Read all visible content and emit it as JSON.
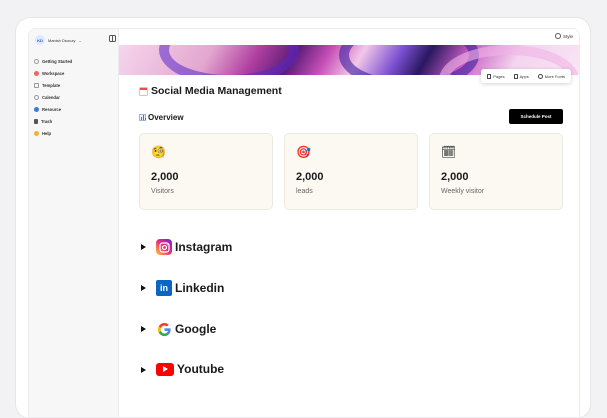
{
  "workspace": {
    "initials": "KD",
    "name": "Manish Dsouzy"
  },
  "sidebar": {
    "items": [
      {
        "label": "Getting Started",
        "icon": "compass-icon",
        "color": "#d9d9d9"
      },
      {
        "label": "Workspace",
        "icon": "workspace-icon",
        "color": "#e9685b"
      },
      {
        "label": "Template",
        "icon": "template-icon",
        "color": "#d9d9d9"
      },
      {
        "label": "Calendar",
        "icon": "calendar-icon",
        "color": "#d9d9d9"
      },
      {
        "label": "Resource",
        "icon": "globe-icon",
        "color": "#3a7bd5"
      },
      {
        "label": "Trash",
        "icon": "trash-icon",
        "color": "#555555"
      },
      {
        "label": "Help",
        "icon": "help-icon",
        "color": "#f2b233"
      }
    ]
  },
  "topbar": {
    "style_label": "Style"
  },
  "cover_menu": {
    "pages": "Pages",
    "apps": "Apps",
    "more_fonts": "More Fonts"
  },
  "page": {
    "title": "Social Media Management",
    "overview": "Overview",
    "schedule_label": "Schedule Post"
  },
  "cards": [
    {
      "value": "2,000",
      "label": "Visitors",
      "emoji": "🧐"
    },
    {
      "value": "2,000",
      "label": "leads",
      "emoji": "🎯"
    },
    {
      "value": "2,000",
      "label": "Weekly visitor",
      "emoji": "🗓"
    }
  ],
  "toggles": [
    {
      "label": "Instagram",
      "icon": "instagram-icon"
    },
    {
      "label": "Linkedin",
      "icon": "linkedin-icon"
    },
    {
      "label": "Google",
      "icon": "google-icon"
    },
    {
      "label": "Youtube",
      "icon": "youtube-icon"
    }
  ]
}
